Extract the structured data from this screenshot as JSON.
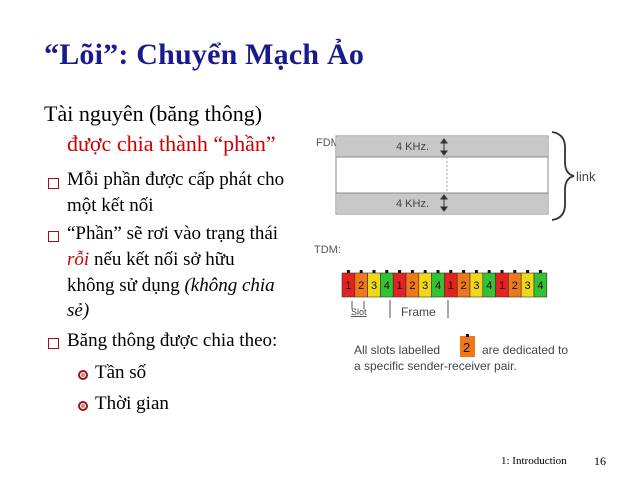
{
  "title": "“Lõi”: Chuyển Mạch Ảo",
  "heading": {
    "line1": "Tài nguyên (băng thông)",
    "line2": "được chia thành “phần”"
  },
  "bullets": [
    {
      "line1": "Mỗi phần được cấp phát cho",
      "line2": "một kết nối"
    },
    {
      "line1": "“Phần” sẽ rơi vào trạng thái",
      "line2_italic": "rỗi",
      "line2_rest": " nếu kết nối sở hữu",
      "line3_plain": "không sử dụng ",
      "line3_italic": "(không chia",
      "line4_italic": "sẻ)"
    },
    {
      "line1": "Băng thông được chia theo:"
    }
  ],
  "sub_bullets": [
    "Tần số",
    "Thời gian"
  ],
  "diagram": {
    "fdm_label": "FDM:",
    "band_label_top": "4 KHz.",
    "band_label_bottom": "4 KHz.",
    "link_label": "link",
    "tdm_label": "TDM:",
    "slots": [
      "1",
      "2",
      "3",
      "4",
      "1",
      "2",
      "3",
      "4",
      "1",
      "2",
      "3",
      "4",
      "1",
      "2",
      "3",
      "4"
    ],
    "slot_colors": [
      "#e52222",
      "#f07818",
      "#f0d818",
      "#33c233"
    ],
    "slot_label": "Slot",
    "frame_label": "Frame",
    "note_prefix": "All slots labelled",
    "note_number": "2",
    "note_suffix": "are dedicated to",
    "note_line2": "a specific sender-receiver pair."
  },
  "footer": {
    "label": "1: Introduction",
    "page": "16"
  }
}
